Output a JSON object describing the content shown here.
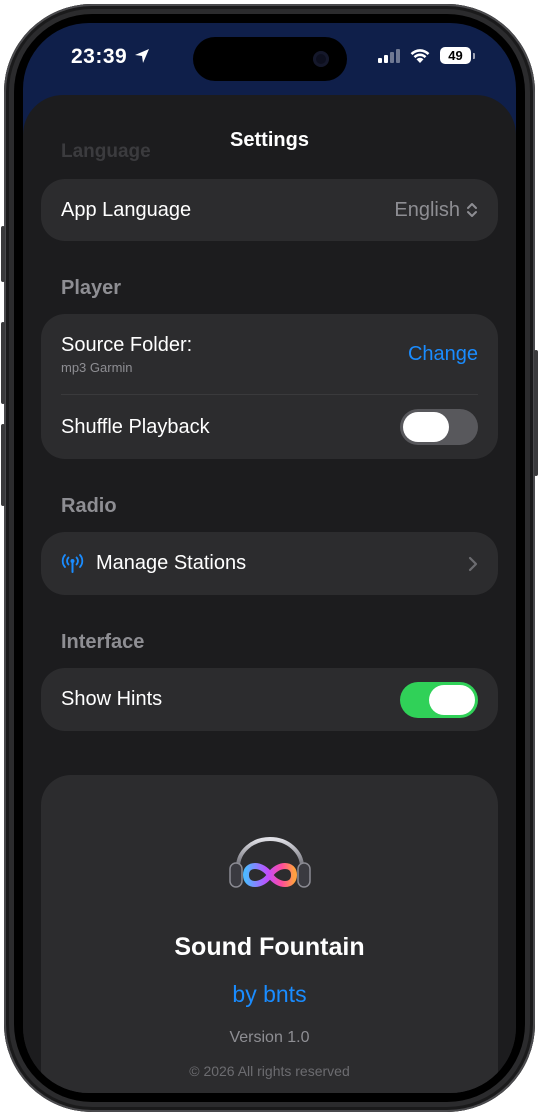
{
  "status_bar": {
    "time": "23:39",
    "battery": "49"
  },
  "sheet": {
    "title": "Settings",
    "faded_header": "Language"
  },
  "language": {
    "label": "App Language",
    "value": "English"
  },
  "player": {
    "header": "Player",
    "source_label": "Source Folder:",
    "source_value": "mp3 Garmin",
    "change_label": "Change",
    "shuffle_label": "Shuffle Playback",
    "shuffle_on": false
  },
  "radio": {
    "header": "Radio",
    "manage_label": "Manage Stations"
  },
  "interface": {
    "header": "Interface",
    "hints_label": "Show Hints",
    "hints_on": true
  },
  "about": {
    "app_name": "Sound Fountain",
    "by": "by bnts",
    "version": "Version 1.0",
    "copyright": "© 2026 All rights reserved"
  },
  "colors": {
    "accent": "#1a8cff",
    "toggle_on": "#30d158",
    "background": "#1c1c1e",
    "card": "#2c2c2e"
  },
  "icons": [
    "location-arrow-icon",
    "signal-icon",
    "wifi-icon",
    "battery-icon",
    "up-down-chevron-icon",
    "antenna-icon",
    "chevron-right-icon",
    "app-logo-icon"
  ]
}
